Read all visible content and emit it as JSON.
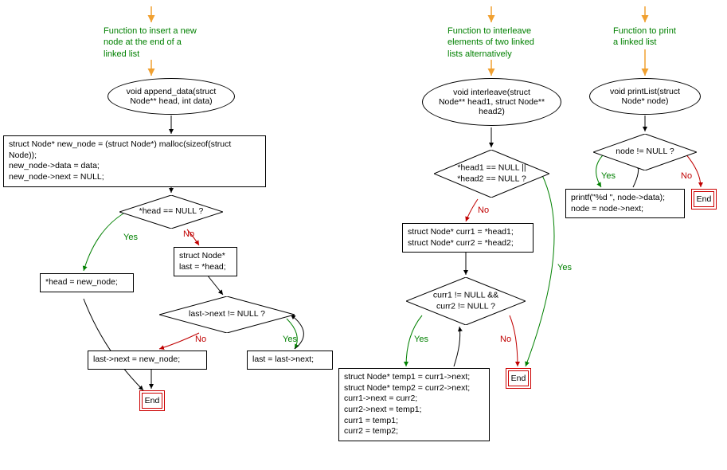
{
  "captions": {
    "append": "Function to insert a new\nnode at the end of a\nlinked list",
    "interleave": "Function to interleave\nelements of two linked\nlists alternatively",
    "print": "Function to print\na linked list"
  },
  "append": {
    "fn": "void append_data(struct\nNode** head, int data)",
    "block1": "struct Node* new_node = (struct Node*) malloc(sizeof(struct Node));\nnew_node->data = data;\nnew_node->next = NULL;",
    "cond1": "*head == NULL ?",
    "then1": "*head = new_node;",
    "else1": "struct Node*\nlast = *head;",
    "cond2": "last->next != NULL ?",
    "then2": "last = last->next;",
    "else2": "last->next = new_node;"
  },
  "interleave": {
    "fn": "void interleave(struct\nNode** head1, struct Node**\nhead2)",
    "cond1": "*head1 == NULL ||\n*head2 == NULL ?",
    "block1": "struct Node* curr1 = *head1;\nstruct Node* curr2 = *head2;",
    "cond2": "curr1 != NULL &&\ncurr2 != NULL ?",
    "block2": "struct Node* temp1 = curr1->next;\nstruct Node* temp2 = curr2->next;\ncurr1->next = curr2;\ncurr2->next = temp1;\ncurr1 = temp1;\ncurr2 = temp2;"
  },
  "print": {
    "fn": "void printList(struct\nNode* node)",
    "cond": "node != NULL ?",
    "block": "printf(\"%d \", node->data);\nnode = node->next;"
  },
  "labels": {
    "yes": "Yes",
    "no": "No",
    "end": "End"
  }
}
